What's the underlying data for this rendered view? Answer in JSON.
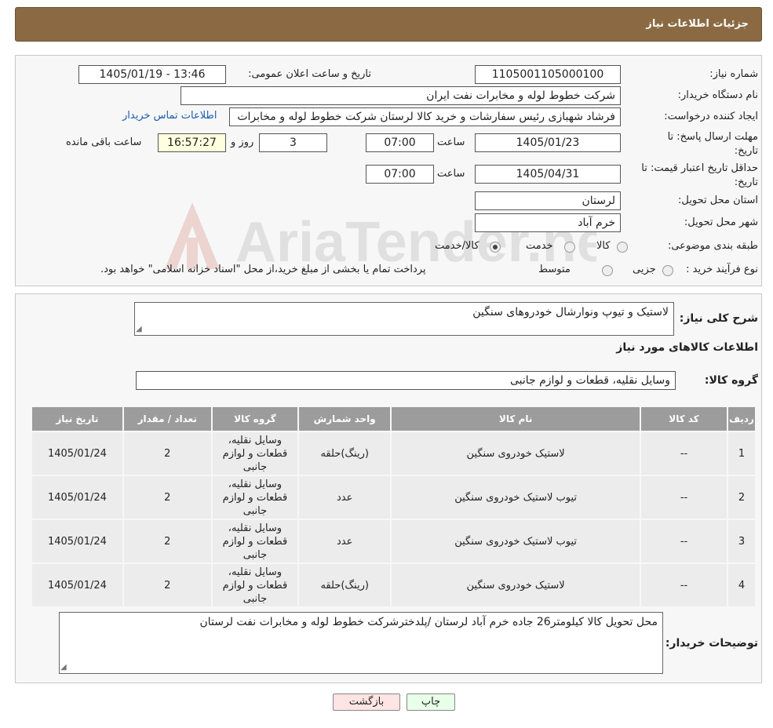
{
  "header": {
    "title": "جزئیات اطلاعات نیاز"
  },
  "form": {
    "need_number_label": "شماره نیاز:",
    "need_number": "1105001105000100",
    "announce_label": "تاریخ و ساعت اعلان عمومی:",
    "announce_value": "1405/01/19 - 13:46",
    "buyer_org_label": "نام دستگاه خریدار:",
    "buyer_org": "شرکت خطوط لوله و مخابرات نفت ایران",
    "requester_label": "ایجاد کننده درخواست:",
    "requester": "فرشاد شهبازی رئیس سفارشات و خرید کالا لرستان شرکت خطوط لوله و مخابرات",
    "contact_link": "اطلاعات تماس خریدار",
    "deadline_label": "مهلت ارسال پاسخ: تا تاریخ:",
    "deadline_date": "1405/01/23",
    "time_label": "ساعت",
    "deadline_time": "07:00",
    "days_value": "3",
    "days_label": "روز و",
    "remaining_value": "16:57:27",
    "remaining_label": "ساعت باقی مانده",
    "min_validity_label": "حداقل تاریخ اعتبار قیمت: تا تاریخ:",
    "validity_date": "1405/04/31",
    "validity_time": "07:00",
    "province_label": "استان محل تحویل:",
    "province": "لرستان",
    "city_label": "شهر محل تحویل:",
    "city": "خرم آباد",
    "category_label": "طبقه بندی موضوعی:",
    "category_options": [
      "کالا",
      "خدمت",
      "کالا/خدمت"
    ],
    "process_label": "نوع فرآیند خرید :",
    "process_options": [
      "جزیی",
      "متوسط"
    ],
    "process_note": "پرداخت تمام یا بخشی از مبلغ خرید،از محل \"اسناد خزانه اسلامی\" خواهد بود."
  },
  "details": {
    "summary_label": "شرح کلی نیاز:",
    "summary": "لاستیک و تیوپ ونوارشال خودروهای سنگین",
    "goods_info_title": "اطلاعات کالاهای مورد نیاز",
    "goods_group_label": "گروه کالا:",
    "goods_group": "وسایل نقلیه، قطعات و لوازم جانبی"
  },
  "table": {
    "headers": [
      "ردیف",
      "کد کالا",
      "نام کالا",
      "واحد شمارش",
      "گروه کالا",
      "تعداد / مقدار",
      "تاریخ نیاز"
    ],
    "rows": [
      [
        "1",
        "--",
        "لاستیک خودروی سنگین",
        "(رینگ)حلقه",
        "وسایل نقلیه، قطعات و لوازم جانبی",
        "2",
        "1405/01/24"
      ],
      [
        "2",
        "--",
        "تیوب لاستیک خودروی سنگین",
        "عدد",
        "وسایل نقلیه، قطعات و لوازم جانبی",
        "2",
        "1405/01/24"
      ],
      [
        "3",
        "--",
        "تیوب لاستیک خودروی سنگین",
        "عدد",
        "وسایل نقلیه، قطعات و لوازم جانبی",
        "2",
        "1405/01/24"
      ],
      [
        "4",
        "--",
        "لاستیک خودروی سنگین",
        "(رینگ)حلقه",
        "وسایل نقلیه، قطعات و لوازم جانبی",
        "2",
        "1405/01/24"
      ]
    ]
  },
  "notes": {
    "label": "توضیحات خریدار:",
    "text": "محل تحویل کالا کیلومتر26 جاده خرم آباد لرستان /پلدخترشرکت خطوط لوله و مخابرات نفت لرستان"
  },
  "buttons": {
    "print": "چاپ",
    "back": "بازگشت"
  },
  "watermark": {
    "text": "AriaTender.neT"
  },
  "colors": {
    "header_bg": "#8b6a43",
    "table_header_bg": "#9c9c9c",
    "back_button_bg": "#ffe4e4",
    "print_button_bg": "#e8ffe8"
  }
}
